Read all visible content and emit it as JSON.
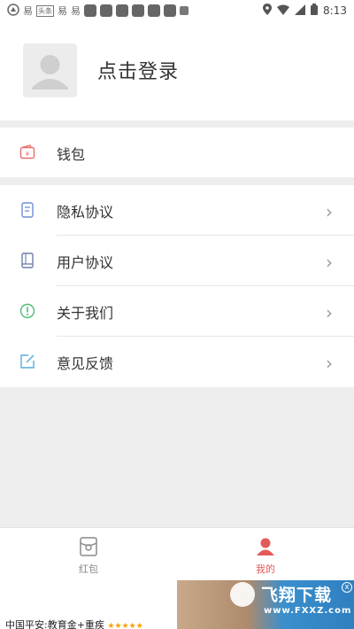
{
  "status_bar": {
    "time": "8:13",
    "left_glyphs": [
      "易",
      "头条",
      "易",
      "易"
    ]
  },
  "profile": {
    "login_text": "点击登录"
  },
  "wallet": {
    "label": "钱包",
    "icon": "wallet-icon"
  },
  "menu": [
    {
      "label": "隐私协议",
      "icon": "document-icon"
    },
    {
      "label": "用户协议",
      "icon": "book-icon"
    },
    {
      "label": "关于我们",
      "icon": "info-icon"
    },
    {
      "label": "意见反馈",
      "icon": "edit-icon"
    }
  ],
  "tabbar": {
    "left_label": "红包",
    "right_label": "我的",
    "active_color": "#e25a59",
    "inactive_color": "#888888"
  },
  "ad": {
    "text": "中国平安:教育金+重疾",
    "stars": "★★★★★",
    "brand": "飞翔下载",
    "site": "www.FXXZ.com",
    "close": "x"
  }
}
